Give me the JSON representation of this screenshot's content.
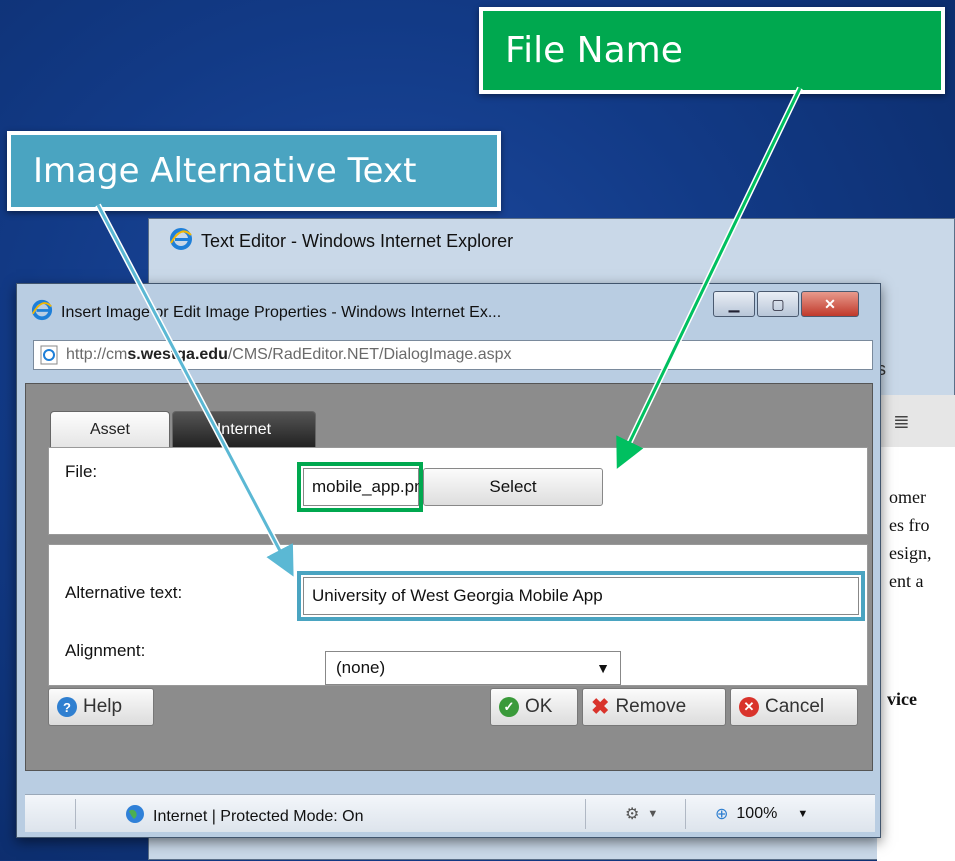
{
  "callouts": {
    "file_name": "File Name",
    "alt_text": "Image Alternative Text"
  },
  "background_window": {
    "title": "Text Editor - Windows Internet Explorer",
    "address_fragment": "s",
    "doc_fragments": [
      "omer",
      "es fro",
      "esign,",
      "ent a",
      "vice"
    ]
  },
  "dialog": {
    "title": "Insert Image or Edit Image Properties - Windows Internet Ex...",
    "address": {
      "prefix": "http://cm",
      "domain": "s.westga.edu",
      "path": "/CMS/RadEditor.NET/DialogImage.aspx"
    },
    "tabs": [
      {
        "label": "Asset",
        "active": true
      },
      {
        "label": "Internet",
        "active": false
      }
    ],
    "file": {
      "label": "File:",
      "value": "mobile_app.png",
      "select_label": "Select"
    },
    "alternative_text": {
      "label": "Alternative text:",
      "value": "University of West Georgia Mobile App"
    },
    "alignment": {
      "label": "Alignment:",
      "value": "(none)"
    },
    "buttons": {
      "help": "Help",
      "ok": "OK",
      "remove": "Remove",
      "cancel": "Cancel"
    },
    "status": {
      "zone": "Internet | Protected Mode: On",
      "zoom": "100%"
    }
  },
  "colors": {
    "green_highlight": "#00a84f",
    "blue_highlight": "#4aa4c1"
  }
}
